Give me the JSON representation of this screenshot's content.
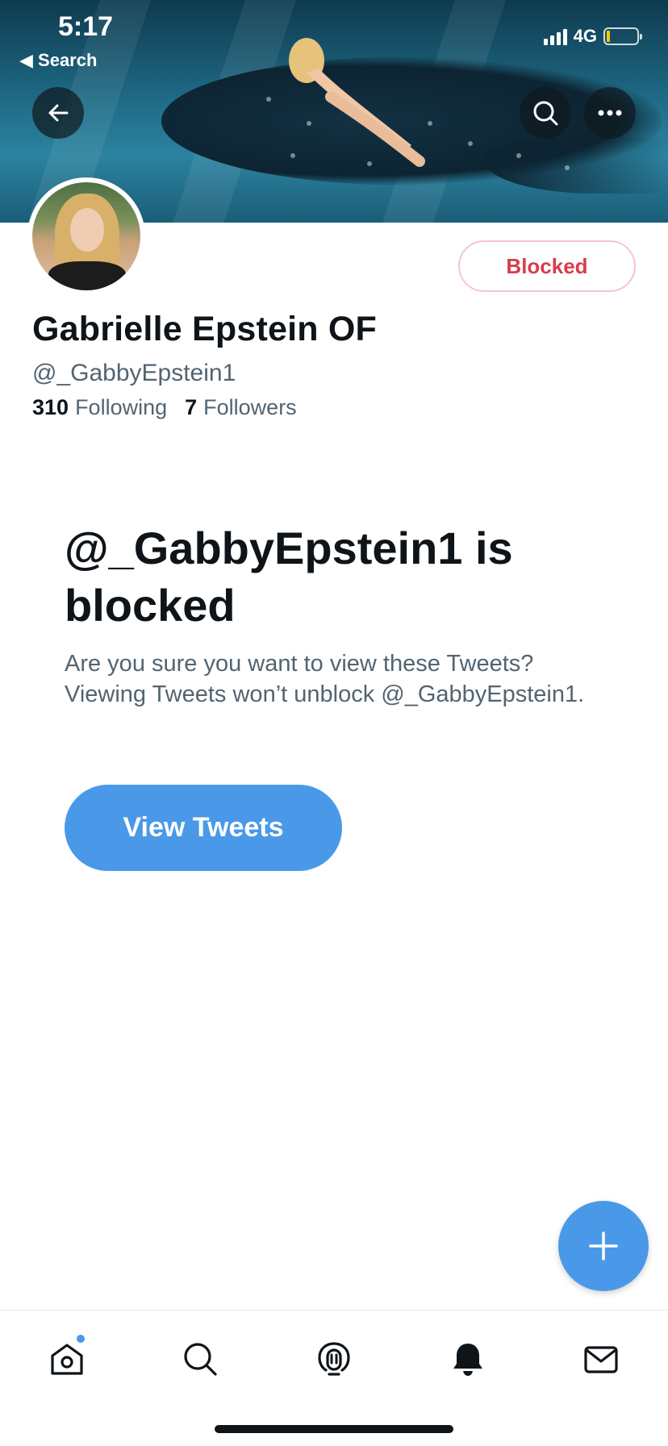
{
  "status_bar": {
    "time": "5:17",
    "back_label": "◀ Search",
    "network": "4G",
    "icons": [
      "signal-icon",
      "battery-icon"
    ]
  },
  "banner": {
    "buttons": [
      "back-arrow-icon",
      "search-icon",
      "more-icon"
    ]
  },
  "profile": {
    "display_name": "Gabrielle Epstein OF",
    "handle": "@_GabbyEpstein1",
    "following_count": "310",
    "following_label": "Following",
    "followers_count": "7",
    "followers_label": "Followers",
    "blocked_button": "Blocked"
  },
  "notice": {
    "title": "@_GabbyEpstein1 is blocked",
    "body": "Are you sure you want to view these Tweets? Viewing Tweets won’t unblock @_GabbyEpstein1.",
    "button": "View Tweets"
  },
  "tabbar": {
    "items": [
      "home-icon",
      "search-icon",
      "spaces-icon",
      "notifications-icon",
      "messages-icon"
    ]
  },
  "colors": {
    "accent": "#4a99e9",
    "blocked_text": "#d93c4a",
    "secondary_text": "#536471"
  }
}
